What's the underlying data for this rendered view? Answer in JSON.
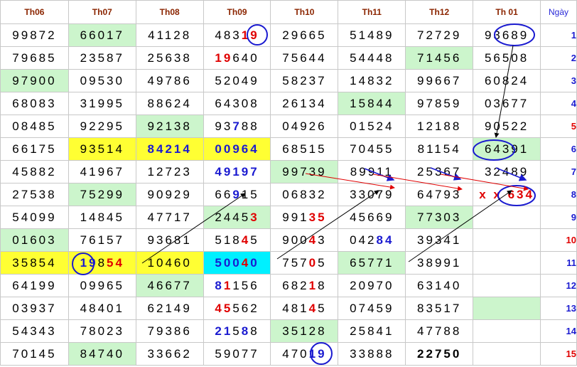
{
  "headers": [
    "Th06",
    "Th07",
    "Th08",
    "Th09",
    "Th10",
    "Th11",
    "Th12",
    "Th 01",
    "Ngày"
  ],
  "rows": [
    {
      "day": "1",
      "day_color": "#1a1ad0",
      "cells": [
        {
          "p": [
            [
              "99872",
              ""
            ]
          ]
        },
        {
          "p": [
            [
              "66017",
              ""
            ]
          ],
          "bg": "green"
        },
        {
          "p": [
            [
              "41128",
              ""
            ]
          ]
        },
        {
          "p": [
            [
              "483",
              ""
            ],
            [
              "19",
              "red"
            ]
          ]
        },
        {
          "p": [
            [
              "29665",
              ""
            ]
          ]
        },
        {
          "p": [
            [
              "51489",
              ""
            ]
          ]
        },
        {
          "p": [
            [
              "72729",
              ""
            ]
          ]
        },
        {
          "p": [
            [
              "93689",
              ""
            ]
          ]
        }
      ]
    },
    {
      "day": "2",
      "day_color": "#1a1ad0",
      "cells": [
        {
          "p": [
            [
              "79685",
              ""
            ]
          ]
        },
        {
          "p": [
            [
              "23587",
              ""
            ]
          ]
        },
        {
          "p": [
            [
              "25638",
              ""
            ]
          ]
        },
        {
          "p": [
            [
              "19",
              "red"
            ],
            [
              "640",
              ""
            ]
          ]
        },
        {
          "p": [
            [
              "75644",
              ""
            ]
          ]
        },
        {
          "p": [
            [
              "54448",
              ""
            ]
          ]
        },
        {
          "p": [
            [
              "71456",
              ""
            ]
          ],
          "bg": "green"
        },
        {
          "p": [
            [
              "56508",
              ""
            ]
          ]
        }
      ]
    },
    {
      "day": "3",
      "day_color": "#1a1ad0",
      "cells": [
        {
          "p": [
            [
              "97900",
              ""
            ]
          ],
          "bg": "green"
        },
        {
          "p": [
            [
              "09530",
              ""
            ]
          ]
        },
        {
          "p": [
            [
              "49786",
              ""
            ]
          ]
        },
        {
          "p": [
            [
              "52049",
              ""
            ]
          ]
        },
        {
          "p": [
            [
              "58237",
              ""
            ]
          ]
        },
        {
          "p": [
            [
              "14832",
              ""
            ]
          ]
        },
        {
          "p": [
            [
              "99667",
              ""
            ]
          ]
        },
        {
          "p": [
            [
              "60824",
              ""
            ]
          ]
        }
      ]
    },
    {
      "day": "4",
      "day_color": "#1a1ad0",
      "cells": [
        {
          "p": [
            [
              "68083",
              ""
            ]
          ]
        },
        {
          "p": [
            [
              "31995",
              ""
            ]
          ]
        },
        {
          "p": [
            [
              "88624",
              ""
            ]
          ]
        },
        {
          "p": [
            [
              "64308",
              ""
            ]
          ]
        },
        {
          "p": [
            [
              "26134",
              ""
            ]
          ]
        },
        {
          "p": [
            [
              "15844",
              ""
            ]
          ],
          "bg": "green"
        },
        {
          "p": [
            [
              "97859",
              ""
            ]
          ]
        },
        {
          "p": [
            [
              "03677",
              ""
            ]
          ]
        }
      ]
    },
    {
      "day": "5",
      "day_color": "#e00000",
      "cells": [
        {
          "p": [
            [
              "08485",
              ""
            ]
          ]
        },
        {
          "p": [
            [
              "92295",
              ""
            ]
          ]
        },
        {
          "p": [
            [
              "92138",
              ""
            ]
          ],
          "bg": "green"
        },
        {
          "p": [
            [
              "93",
              ""
            ],
            [
              "7",
              "blue"
            ],
            [
              "88",
              ""
            ]
          ]
        },
        {
          "p": [
            [
              "04926",
              ""
            ]
          ]
        },
        {
          "p": [
            [
              "01524",
              ""
            ]
          ]
        },
        {
          "p": [
            [
              "12188",
              ""
            ]
          ]
        },
        {
          "p": [
            [
              "90522",
              ""
            ]
          ]
        }
      ]
    },
    {
      "day": "6",
      "day_color": "#1a1ad0",
      "cells": [
        {
          "p": [
            [
              "66175",
              ""
            ]
          ]
        },
        {
          "p": [
            [
              "93514",
              ""
            ]
          ],
          "bg": "yellow"
        },
        {
          "p": [
            [
              "84214",
              "blue"
            ]
          ],
          "bg": "yellow"
        },
        {
          "p": [
            [
              "00964",
              "blue"
            ]
          ],
          "bg": "yellow"
        },
        {
          "p": [
            [
              "68515",
              ""
            ]
          ]
        },
        {
          "p": [
            [
              "70455",
              ""
            ]
          ]
        },
        {
          "p": [
            [
              "81154",
              ""
            ]
          ]
        },
        {
          "p": [
            [
              "64391",
              ""
            ]
          ],
          "bg": "green"
        }
      ]
    },
    {
      "day": "7",
      "day_color": "#1a1ad0",
      "cells": [
        {
          "p": [
            [
              "45882",
              ""
            ]
          ]
        },
        {
          "p": [
            [
              "41967",
              ""
            ]
          ]
        },
        {
          "p": [
            [
              "12723",
              ""
            ]
          ]
        },
        {
          "p": [
            [
              "49197",
              "blue"
            ]
          ]
        },
        {
          "p": [
            [
              "99739",
              ""
            ]
          ],
          "bg": "green"
        },
        {
          "p": [
            [
              "89911",
              ""
            ]
          ]
        },
        {
          "p": [
            [
              "25367",
              ""
            ]
          ]
        },
        {
          "p": [
            [
              "32489",
              ""
            ]
          ]
        }
      ]
    },
    {
      "day": "8",
      "day_color": "#1a1ad0",
      "cells": [
        {
          "p": [
            [
              "27538",
              ""
            ]
          ]
        },
        {
          "p": [
            [
              "75299",
              ""
            ]
          ],
          "bg": "green"
        },
        {
          "p": [
            [
              "90929",
              ""
            ]
          ]
        },
        {
          "p": [
            [
              "66",
              ""
            ],
            [
              "9",
              "blue"
            ],
            [
              "15",
              ""
            ]
          ]
        },
        {
          "p": [
            [
              "06832",
              ""
            ]
          ]
        },
        {
          "p": [
            [
              "33079",
              ""
            ]
          ]
        },
        {
          "p": [
            [
              "64793",
              ""
            ]
          ]
        },
        {
          "p": [
            [
              "x x ",
              "red"
            ],
            [
              "634",
              "red"
            ]
          ]
        }
      ]
    },
    {
      "day": "9",
      "day_color": "#1a1ad0",
      "cells": [
        {
          "p": [
            [
              "54099",
              ""
            ]
          ]
        },
        {
          "p": [
            [
              "14845",
              ""
            ]
          ]
        },
        {
          "p": [
            [
              "47717",
              ""
            ]
          ]
        },
        {
          "p": [
            [
              "2445",
              ""
            ],
            [
              "3",
              "red"
            ]
          ],
          "bg": "green"
        },
        {
          "p": [
            [
              "991",
              ""
            ],
            [
              "35",
              "red"
            ]
          ]
        },
        {
          "p": [
            [
              "45669",
              ""
            ]
          ]
        },
        {
          "p": [
            [
              "77303",
              ""
            ]
          ],
          "bg": "green"
        },
        {
          "p": [
            [
              "",
              ""
            ]
          ]
        }
      ]
    },
    {
      "day": "10",
      "day_color": "#e00000",
      "cells": [
        {
          "p": [
            [
              "01603",
              ""
            ]
          ],
          "bg": "green"
        },
        {
          "p": [
            [
              "76157",
              ""
            ]
          ]
        },
        {
          "p": [
            [
              "93681",
              ""
            ]
          ]
        },
        {
          "p": [
            [
              "518",
              ""
            ],
            [
              "4",
              "red"
            ],
            [
              "5",
              ""
            ]
          ]
        },
        {
          "p": [
            [
              "900",
              ""
            ],
            [
              "4",
              "red"
            ],
            [
              "3",
              ""
            ]
          ]
        },
        {
          "p": [
            [
              "042",
              ""
            ],
            [
              "84",
              "blue"
            ]
          ]
        },
        {
          "p": [
            [
              "39341",
              ""
            ]
          ]
        },
        {
          "p": [
            [
              "",
              ""
            ]
          ]
        }
      ]
    },
    {
      "day": "11",
      "day_color": "#1a1ad0",
      "cells": [
        {
          "p": [
            [
              "35854",
              ""
            ]
          ],
          "bg": "yellow"
        },
        {
          "p": [
            [
              "19",
              "blue"
            ],
            [
              "8",
              ""
            ],
            [
              "54",
              "red"
            ]
          ],
          "bg": "yellow"
        },
        {
          "p": [
            [
              "10460",
              ""
            ]
          ],
          "bg": "yellow"
        },
        {
          "p": [
            [
              "500",
              "blue"
            ],
            [
              "4",
              "red"
            ],
            [
              "0",
              "blue"
            ]
          ],
          "bg": "cyan"
        },
        {
          "p": [
            [
              "757",
              ""
            ],
            [
              "0",
              "red"
            ],
            [
              "5",
              ""
            ]
          ]
        },
        {
          "p": [
            [
              "65771",
              ""
            ]
          ],
          "bg": "green"
        },
        {
          "p": [
            [
              "38991",
              ""
            ]
          ]
        },
        {
          "p": [
            [
              "",
              ""
            ]
          ]
        }
      ]
    },
    {
      "day": "12",
      "day_color": "#1a1ad0",
      "cells": [
        {
          "p": [
            [
              "64199",
              ""
            ]
          ]
        },
        {
          "p": [
            [
              "09965",
              ""
            ]
          ]
        },
        {
          "p": [
            [
              "46677",
              ""
            ]
          ],
          "bg": "green"
        },
        {
          "p": [
            [
              "8",
              "blue"
            ],
            [
              "1",
              "red"
            ],
            [
              "156",
              ""
            ]
          ]
        },
        {
          "p": [
            [
              "682",
              ""
            ],
            [
              "1",
              "red"
            ],
            [
              "8",
              ""
            ]
          ]
        },
        {
          "p": [
            [
              "20970",
              ""
            ]
          ]
        },
        {
          "p": [
            [
              "63140",
              ""
            ]
          ]
        },
        {
          "p": [
            [
              "",
              ""
            ]
          ]
        }
      ]
    },
    {
      "day": "13",
      "day_color": "#1a1ad0",
      "cells": [
        {
          "p": [
            [
              "03937",
              ""
            ]
          ]
        },
        {
          "p": [
            [
              "48401",
              ""
            ]
          ]
        },
        {
          "p": [
            [
              "62149",
              ""
            ]
          ]
        },
        {
          "p": [
            [
              "45",
              "red"
            ],
            [
              "562",
              ""
            ]
          ]
        },
        {
          "p": [
            [
              "481",
              ""
            ],
            [
              "4",
              "red"
            ],
            [
              "5",
              ""
            ]
          ]
        },
        {
          "p": [
            [
              "07459",
              ""
            ]
          ]
        },
        {
          "p": [
            [
              "83517",
              ""
            ]
          ]
        },
        {
          "p": [
            [
              "",
              ""
            ]
          ],
          "bg": "green"
        }
      ]
    },
    {
      "day": "14",
      "day_color": "#1a1ad0",
      "cells": [
        {
          "p": [
            [
              "54343",
              ""
            ]
          ]
        },
        {
          "p": [
            [
              "78023",
              ""
            ]
          ]
        },
        {
          "p": [
            [
              "79386",
              ""
            ]
          ]
        },
        {
          "p": [
            [
              "21",
              "blue"
            ],
            [
              "5",
              ""
            ],
            [
              "8",
              "blue"
            ],
            [
              "8",
              ""
            ]
          ]
        },
        {
          "p": [
            [
              "35128",
              ""
            ]
          ],
          "bg": "green"
        },
        {
          "p": [
            [
              "25841",
              ""
            ]
          ]
        },
        {
          "p": [
            [
              "47788",
              ""
            ]
          ]
        },
        {
          "p": [
            [
              "",
              ""
            ]
          ]
        }
      ]
    },
    {
      "day": "15",
      "day_color": "#e00000",
      "cells": [
        {
          "p": [
            [
              "70145",
              ""
            ]
          ]
        },
        {
          "p": [
            [
              "84740",
              ""
            ]
          ],
          "bg": "green"
        },
        {
          "p": [
            [
              "33662",
              ""
            ]
          ]
        },
        {
          "p": [
            [
              "59077",
              ""
            ]
          ]
        },
        {
          "p": [
            [
              "470",
              ""
            ],
            [
              "19",
              "blue"
            ]
          ]
        },
        {
          "p": [
            [
              "33888",
              ""
            ]
          ]
        },
        {
          "p": [
            [
              "22750",
              "bold"
            ]
          ]
        },
        {
          "p": [
            [
              "",
              ""
            ]
          ]
        }
      ]
    }
  ]
}
